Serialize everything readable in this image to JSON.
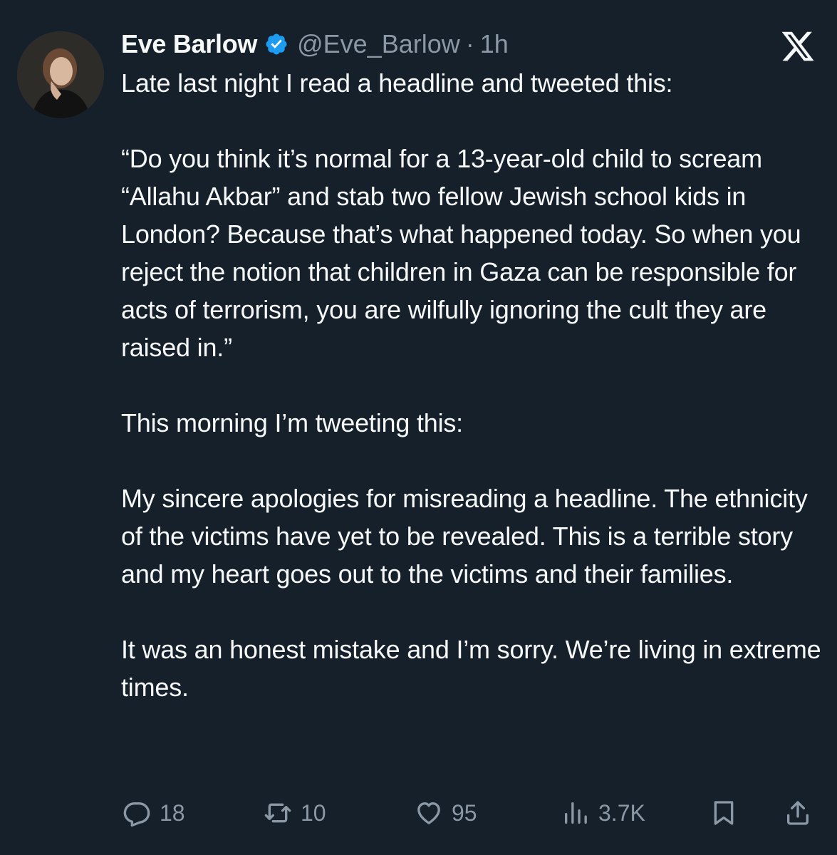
{
  "author": {
    "display_name": "Eve Barlow",
    "handle": "@Eve_Barlow",
    "separator": "·",
    "time": "1h",
    "verified": true,
    "avatar_icon": "avatar-photo"
  },
  "platform_logo": "x-logo-icon",
  "tweet_text": "Late last night I read a headline and tweeted this:\n\n“Do you think it’s normal for a 13-year-old child to scream “Allahu Akbar” and stab two fellow Jewish school kids in London? Because that’s what happened today. So when you reject the notion that children in Gaza can be responsible for acts of terrorism, you are wilfully ignoring the cult they are raised in.”\n\nThis morning I’m tweeting this:\n\nMy sincere apologies for misreading a headline. The ethnicity of the victims have yet to be revealed. This is a terrible story and my heart goes out to the victims and their families.\n\nIt was an honest mistake and I’m sorry. We’re living in extreme times.",
  "actions": {
    "replies": "18",
    "retweets": "10",
    "likes": "95",
    "views": "3.7K"
  },
  "colors": {
    "background": "#15202b",
    "text": "#f7f9f9",
    "muted": "#8b98a5",
    "verified": "#1d9bf0"
  }
}
